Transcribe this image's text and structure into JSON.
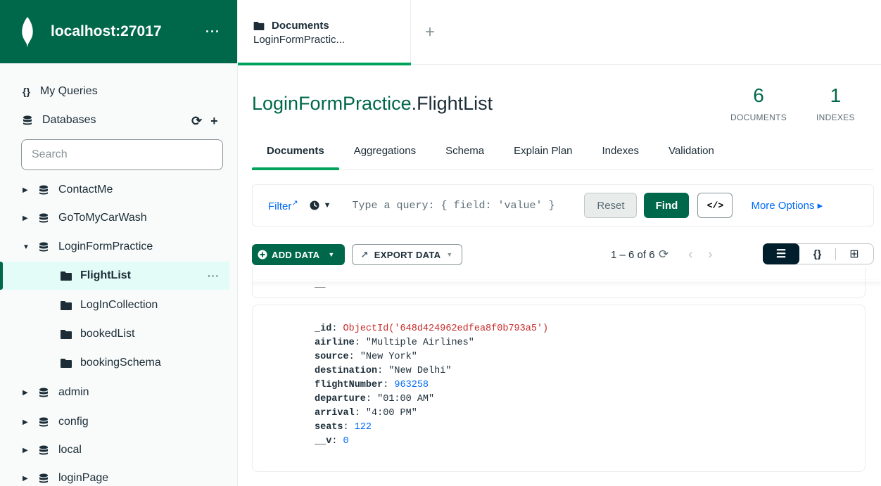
{
  "sidebar": {
    "connection_title": "localhost:27017",
    "more_label": "···",
    "my_queries_label": "My Queries",
    "databases_label": "Databases",
    "search_placeholder": "Search",
    "databases": [
      {
        "name": "ContactMe",
        "expanded": false
      },
      {
        "name": "GoToMyCarWash",
        "expanded": false
      },
      {
        "name": "LoginFormPractice",
        "expanded": true,
        "collections": [
          "FlightList",
          "LogInCollection",
          "bookedList",
          "bookingSchema"
        ],
        "active_collection": "FlightList"
      },
      {
        "name": "admin",
        "expanded": false
      },
      {
        "name": "config",
        "expanded": false
      },
      {
        "name": "local",
        "expanded": false
      },
      {
        "name": "loginPage",
        "expanded": false
      }
    ]
  },
  "tab": {
    "title": "Documents",
    "subtitle": "LoginFormPractic..."
  },
  "collection": {
    "db_name": "LoginFormPractice",
    "coll_name": ".FlightList",
    "documents_count": "6",
    "documents_label": "DOCUMENTS",
    "indexes_count": "1",
    "indexes_label": "INDEXES"
  },
  "subtabs": [
    "Documents",
    "Aggregations",
    "Schema",
    "Explain Plan",
    "Indexes",
    "Validation"
  ],
  "filter": {
    "filter_label": "Filter",
    "query_placeholder": "Type a query: { field: 'value' }",
    "reset_label": "Reset",
    "find_label": "Find",
    "code_label": "</>",
    "more_options_label": "More Options ▸"
  },
  "toolbar": {
    "add_data_label": "ADD DATA",
    "export_data_label": "EXPORT DATA",
    "pager_text": "1 – 6 of 6"
  },
  "prev_doc_tail": "__",
  "document": {
    "_id": "ObjectId('648d424962edfea8f0b793a5')",
    "airline": "\"Multiple Airlines\"",
    "source": "\"New York\"",
    "destination": "\"New Delhi\"",
    "flightNumber": "963258",
    "departure": "\"01:00 AM\"",
    "arrival": "\"4:00 PM\"",
    "seats": "122",
    "__v": "0"
  },
  "colors": {
    "brand_green": "#00684a",
    "accent_green": "#00a35c",
    "link_blue": "#016bf8",
    "objectid_red": "#c62b2b"
  }
}
